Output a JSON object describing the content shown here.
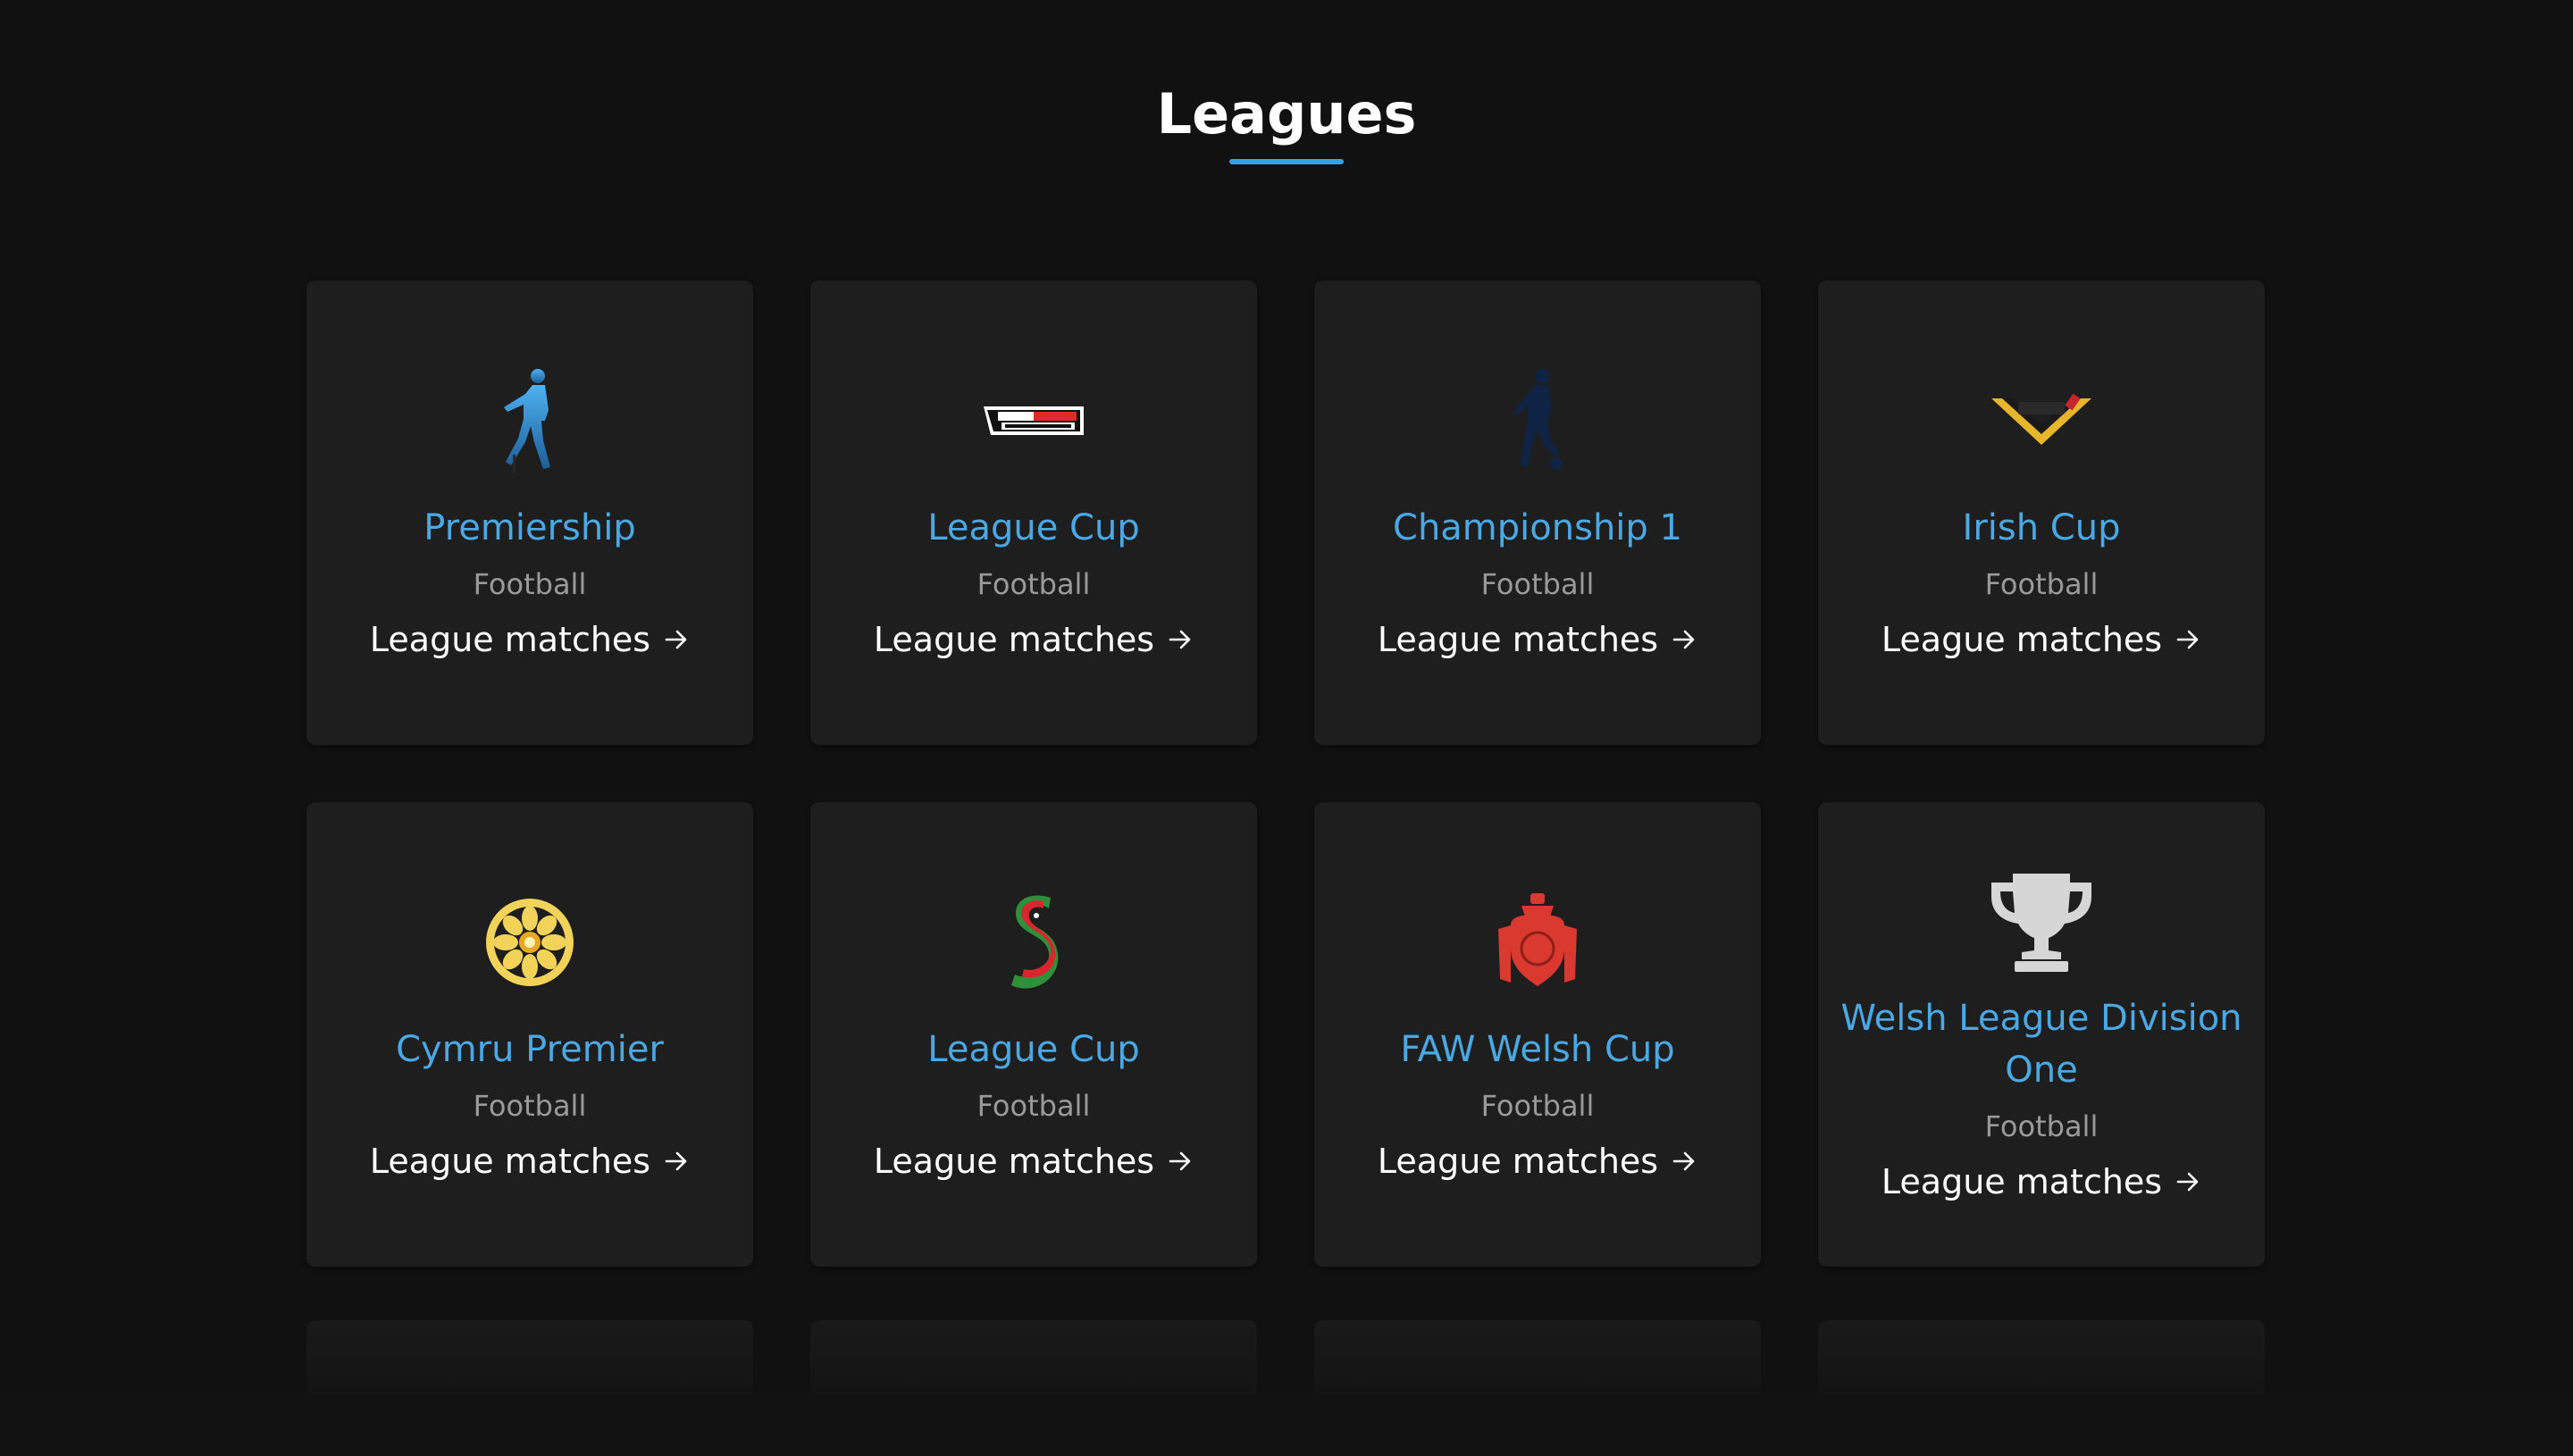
{
  "page": {
    "title": "Leagues",
    "accent_color": "#3b9fe0",
    "link_arrow": "→"
  },
  "leagues": [
    {
      "name": "Premiership",
      "sport": "Football",
      "link": "League matches",
      "logo": "player-silhouette-blue-icon"
    },
    {
      "name": "League Cup",
      "sport": "Football",
      "link": "League matches",
      "logo": "betmclean-league-cup-logo"
    },
    {
      "name": "Championship 1",
      "sport": "Football",
      "link": "League matches",
      "logo": "player-silhouette-navy-icon"
    },
    {
      "name": "Irish Cup",
      "sport": "Football",
      "link": "League matches",
      "logo": "irish-cup-chevron-logo"
    },
    {
      "name": "Cymru Premier",
      "sport": "Football",
      "link": "League matches",
      "logo": "daffodil-badge-logo"
    },
    {
      "name": "League Cup",
      "sport": "Football",
      "link": "League matches",
      "logo": "dragon-s-logo"
    },
    {
      "name": "FAW Welsh Cup",
      "sport": "Football",
      "link": "League matches",
      "logo": "faw-crest-logo"
    },
    {
      "name": "Welsh League Division One",
      "sport": "Football",
      "link": "League matches",
      "logo": "trophy-icon"
    }
  ]
}
